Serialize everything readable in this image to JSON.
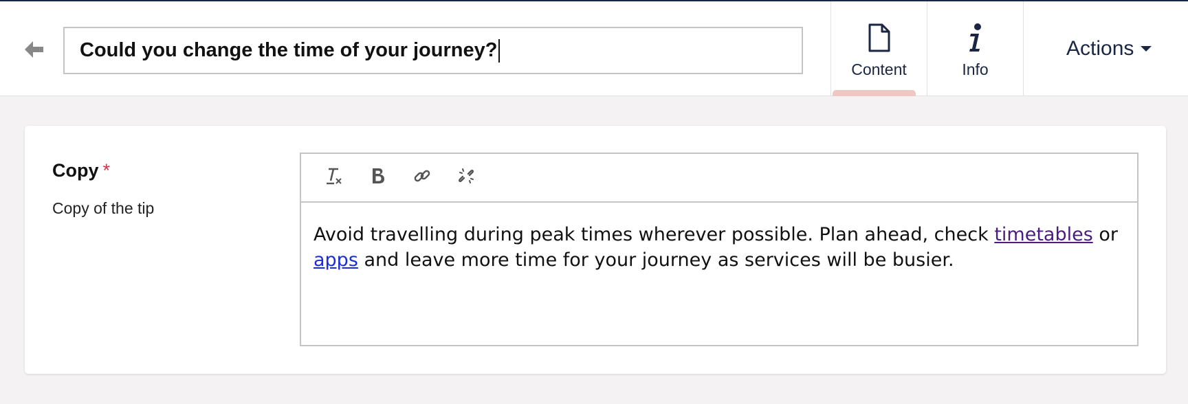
{
  "header": {
    "title_value": "Could you change the time of your journey?",
    "tabs": [
      {
        "label": "Content",
        "icon": "document-icon",
        "active": true
      },
      {
        "label": "Info",
        "icon": "info-icon",
        "active": false
      }
    ],
    "actions_label": "Actions"
  },
  "field": {
    "label": "Copy",
    "required_mark": "*",
    "description": "Copy of the tip"
  },
  "editor": {
    "toolbar": [
      {
        "name": "clear-formatting-icon"
      },
      {
        "name": "bold-icon"
      },
      {
        "name": "link-icon"
      },
      {
        "name": "unlink-icon"
      }
    ],
    "text_part_1": "Avoid travelling during peak times wherever possible. Plan ahead, check ",
    "link_1": "timetables",
    "text_part_2": " or ",
    "link_2": "apps",
    "text_part_3": " and leave more time for your journey as services will be busier."
  },
  "colors": {
    "brand_dark": "#1b2642",
    "active_tab_indicator": "#f0c7c2",
    "required": "#d0334b",
    "visited_link": "#4b1c80",
    "link": "#1a2ed8",
    "background": "#f4f2f2"
  }
}
